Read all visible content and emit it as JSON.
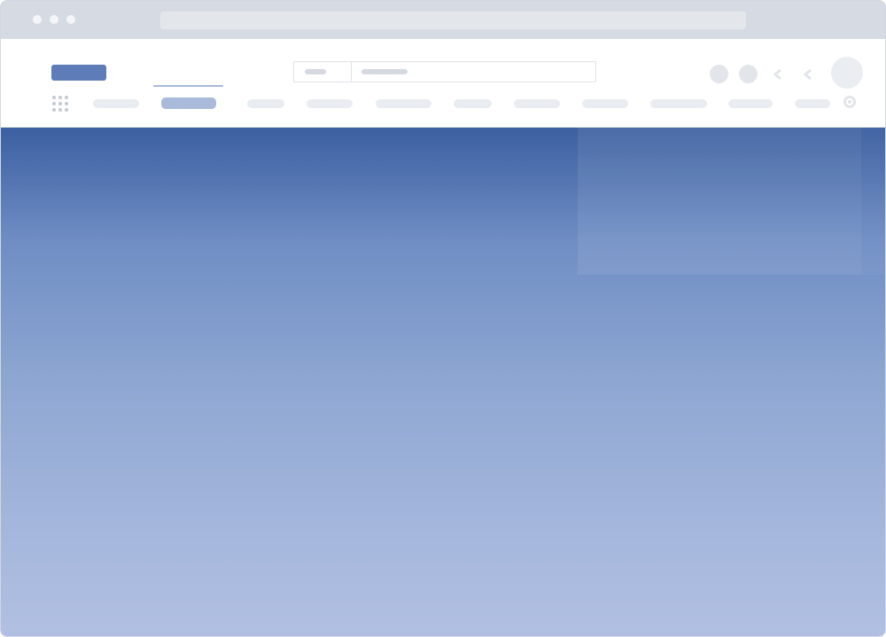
{
  "window": {
    "title": ""
  },
  "browser": {
    "url": ""
  },
  "header": {
    "search": {
      "scope": "",
      "placeholder": ""
    },
    "nav": {
      "active_index": 1,
      "items": [
        "",
        "",
        "",
        "",
        "",
        "",
        "",
        "",
        "",
        "",
        "",
        ""
      ]
    }
  },
  "icons": {
    "apps": "apps-grid-icon",
    "settings": "gear-icon",
    "back": "chevron-left-icon",
    "forward": "chevron-left-icon"
  },
  "colors": {
    "brand": "#5e7db8",
    "active_nav": "#a9badb",
    "hero_top": "#3b5fa0",
    "hero_bottom": "#b1c0e2"
  }
}
